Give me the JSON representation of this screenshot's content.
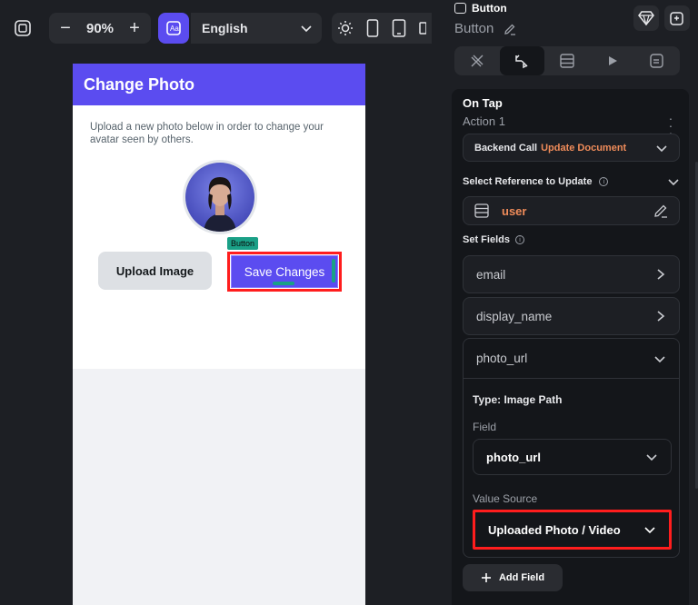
{
  "toolbar": {
    "zoom_minus": "−",
    "zoom_value": "90%",
    "zoom_plus": "+",
    "language": "English",
    "icons": [
      "canvas-icon",
      "translate-icon",
      "sun-icon",
      "phone-icon",
      "tablet-icon"
    ]
  },
  "phone": {
    "title": "Change Photo",
    "description": "Upload a new photo below in order to change your avatar seen by others.",
    "upload_label": "Upload Image",
    "selection_tag": "Button",
    "save_label": "Save Changes",
    "colors": {
      "primary": "#5b4cf0",
      "selection": "#1aa087",
      "highlight": "#ff1d1d"
    }
  },
  "panel": {
    "widget_type": "Button",
    "widget_name": "Button",
    "tabs": [
      "properties-tab",
      "actions-tab",
      "backend-query-tab",
      "preview-tab",
      "notes-tab"
    ],
    "active_tab": 1,
    "on_tap": "On Tap",
    "action_label": "Action 1",
    "backend_call": "Backend Call",
    "backend_action": "Update Document",
    "select_ref_label": "Select Reference to Update",
    "ref_value": "user",
    "set_fields_label": "Set Fields",
    "fields": [
      "email",
      "display_name"
    ],
    "expanded": {
      "name": "photo_url",
      "type": "Type: Image Path",
      "field_label": "Field",
      "field_value": "photo_url",
      "source_label": "Value Source",
      "source_value": "Uploaded Photo / Video"
    },
    "add_field": "Add Field",
    "accent_orange": "#f08c5a"
  }
}
